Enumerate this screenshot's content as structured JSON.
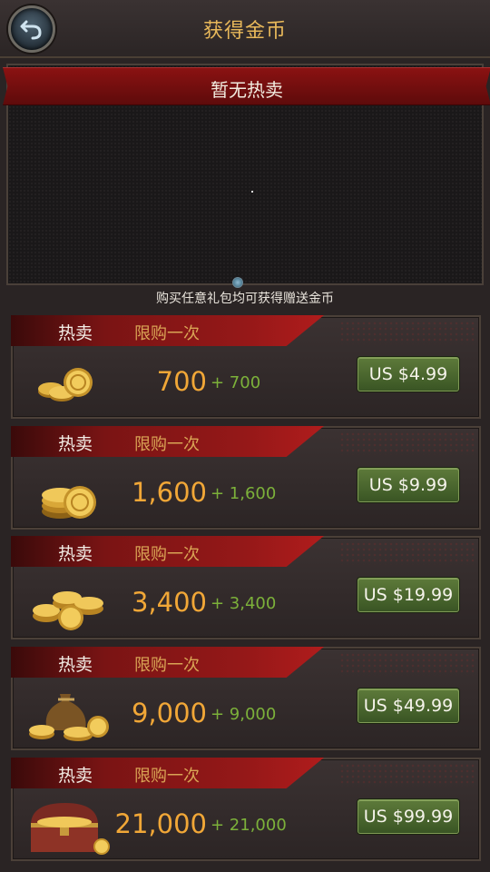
{
  "header": {
    "title": "获得金币"
  },
  "hot_panel": {
    "banner": "暂无热卖"
  },
  "bonus_note": "购买任意礼包均可获得赠送金币",
  "offers": [
    {
      "tag_hot": "热卖",
      "tag_limit": "限购一次",
      "amount": "700",
      "bonus": "+ 700",
      "price": "US $4.99"
    },
    {
      "tag_hot": "热卖",
      "tag_limit": "限购一次",
      "amount": "1,600",
      "bonus": "+ 1,600",
      "price": "US $9.99"
    },
    {
      "tag_hot": "热卖",
      "tag_limit": "限购一次",
      "amount": "3,400",
      "bonus": "+ 3,400",
      "price": "US $19.99"
    },
    {
      "tag_hot": "热卖",
      "tag_limit": "限购一次",
      "amount": "9,000",
      "bonus": "+ 9,000",
      "price": "US $49.99"
    },
    {
      "tag_hot": "热卖",
      "tag_limit": "限购一次",
      "amount": "21,000",
      "bonus": "+ 21,000",
      "price": "US $99.99"
    }
  ],
  "icons": {
    "back": "back-arrow-icon",
    "offer_images": [
      "coins-small-icon",
      "coins-stack-icon",
      "coins-pile-icon",
      "coin-bag-icon",
      "treasure-chest-icon"
    ]
  },
  "colors": {
    "title": "#e8b85a",
    "amount": "#f1a737",
    "bonus": "#7cb13a",
    "banner": "#8a1212",
    "price_button": "#4a6a2e"
  }
}
